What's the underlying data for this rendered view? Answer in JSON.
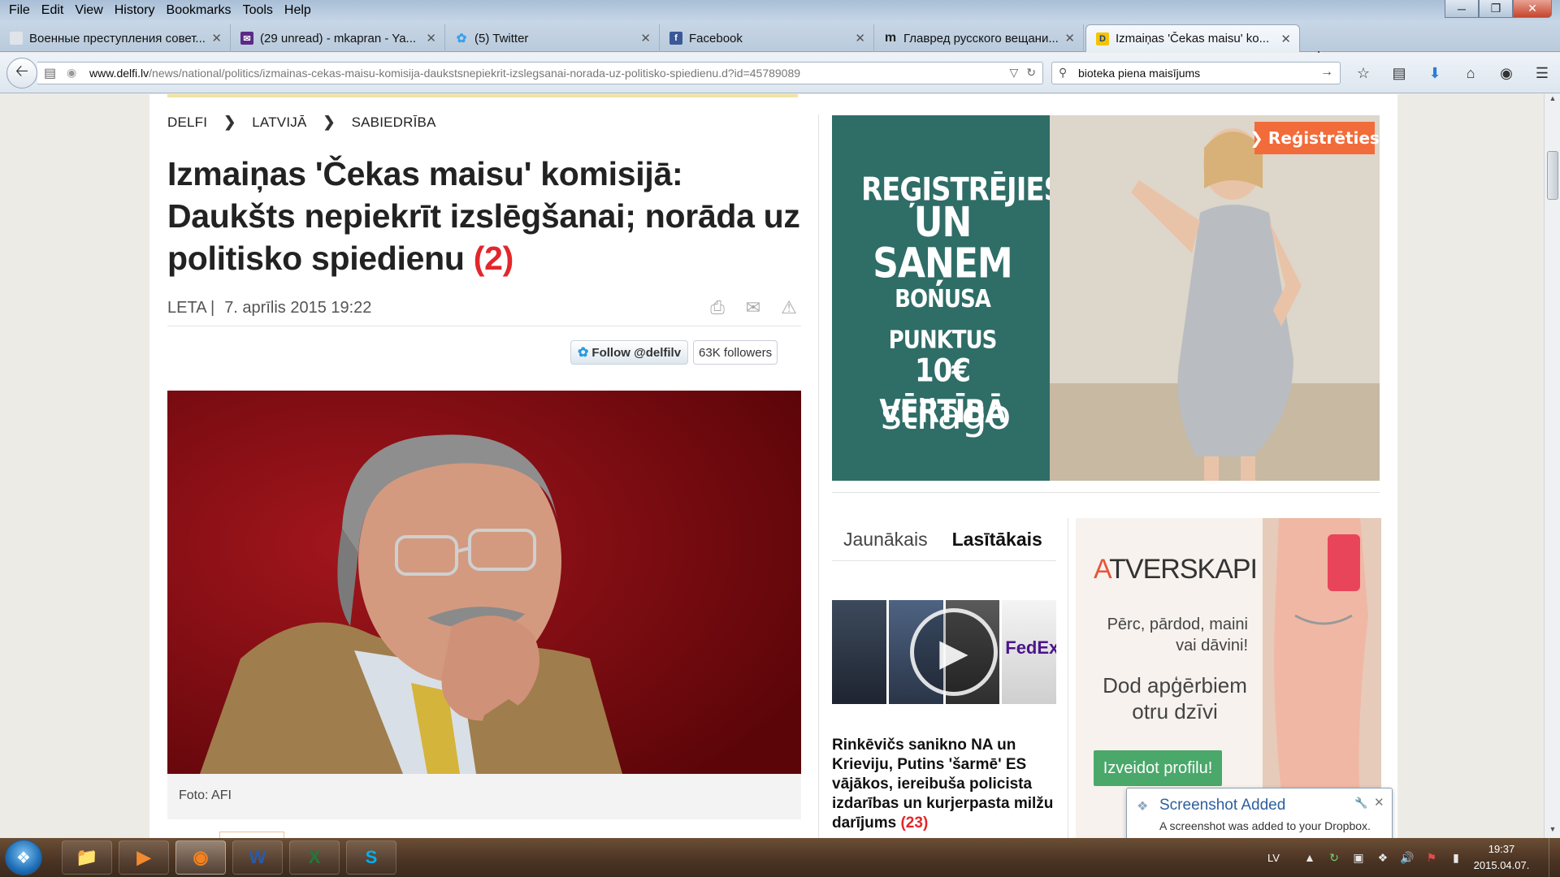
{
  "menu": [
    "File",
    "Edit",
    "View",
    "History",
    "Bookmarks",
    "Tools",
    "Help"
  ],
  "tabs": [
    {
      "title": "Военные преступления совет...",
      "icon": "generic-page-icon",
      "active": false
    },
    {
      "title": "(29 unread) - mkapran - Ya...",
      "icon": "yahoo-mail-icon",
      "active": false
    },
    {
      "title": "(5) Twitter",
      "icon": "twitter-bird-icon",
      "active": false
    },
    {
      "title": "Facebook",
      "icon": "facebook-icon",
      "active": false
    },
    {
      "title": "Главред русского вещани...",
      "icon": "m-letter-icon",
      "active": false
    },
    {
      "title": "Izmaiņas 'Čekas maisu' ko...",
      "icon": "delfi-icon",
      "active": true
    }
  ],
  "url": {
    "host": "www.delfi.lv",
    "path": "/news/national/politics/izmainas-cekas-maisu-komisija-daukstsnepiekrit-izslegsanai-norada-uz-politisko-spiedienu.d?id=45789089"
  },
  "search": {
    "value": "bioteka piena maisījums"
  },
  "breadcrumb": [
    "DELFI",
    "LATVIJĀ",
    "SABIEDRĪBA"
  ],
  "article": {
    "headline": "Izmaiņas 'Čekas maisu' komisijā: Daukšts nepiekrīt izslēgšanai; norāda uz politisko spiedienu",
    "comment_count": "(2)",
    "source": "LETA |",
    "date": "7. aprīlis 2015 19:22",
    "photo_caption": "Foto: AFI"
  },
  "twitter": {
    "follow_label": "Follow @delfilv",
    "followers": "63K followers"
  },
  "ad_stilago": {
    "lines": [
      "REĢISTRĒJIES",
      "UN SAŅEM",
      "BONUSA PUNKTUS",
      "10€ VĒRTĪBĀ"
    ],
    "brand": "stilago",
    "cta": "Reģistrēties"
  },
  "news_tabs": {
    "latest": "Jaunākais",
    "most_read": "Lasītākais"
  },
  "news_item": {
    "headline": "Rinkēvičs sanikno NA un Krieviju, Putins 'šarmē' ES vājākos, iereibuša policista izdarības un kurjerpasta milžu darījums",
    "comments": "(23)",
    "thumb_text": "FedEx"
  },
  "ad_atverskapi": {
    "logo_a": "A",
    "logo_rest": "TVERSKAPI",
    "line1": "Pērc, pārdod, maini vai dāvini!",
    "line2": "Dod apģērbiem otru dzīvi",
    "cta": "Izveidot profilu!"
  },
  "toast": {
    "title": "Screenshot Added",
    "body": "A screenshot was added to your Dropbox."
  },
  "taskbar": {
    "apps": [
      "explorer-icon",
      "media-player-icon",
      "firefox-icon",
      "word-icon",
      "excel-icon",
      "skype-icon"
    ],
    "lang": "LV",
    "time": "19:37",
    "date": "2015.04.07."
  },
  "colors": {
    "accent_red": "#e3262b",
    "stilago_teal": "#2f6d67",
    "cta_orange": "#f26b3a",
    "cta_green": "#4aa86a"
  }
}
